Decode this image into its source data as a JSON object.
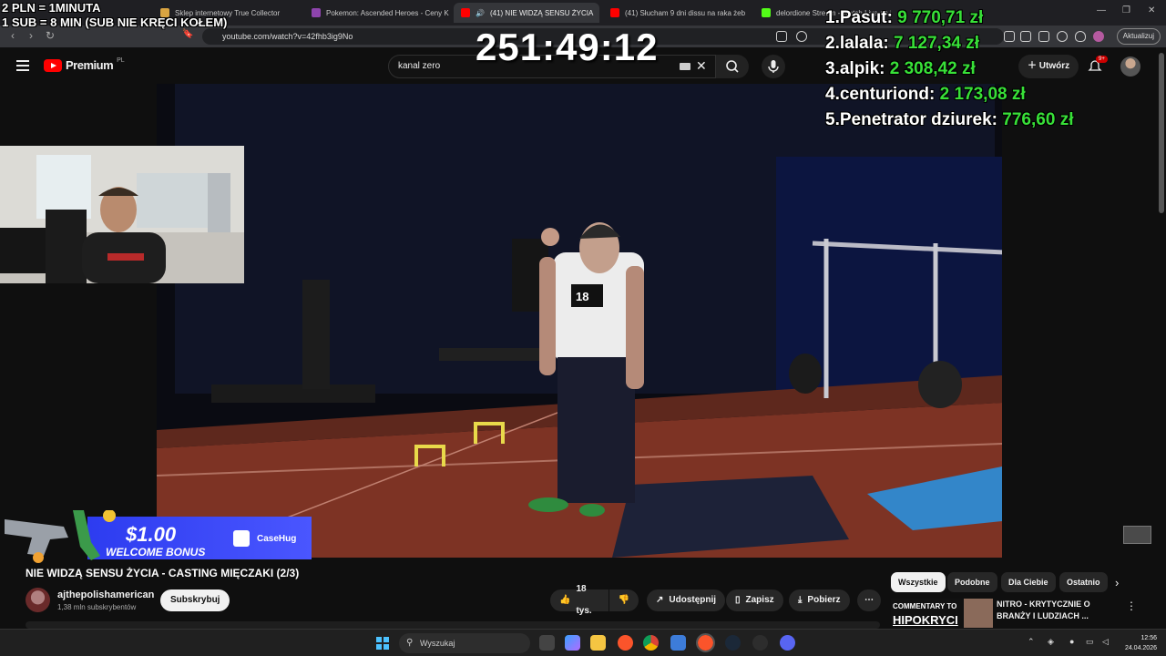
{
  "browser": {
    "tabs": [
      {
        "label": "Sklep internetowy True Collector",
        "favicon_color": "#d9a441"
      },
      {
        "label": "Pokemon: Ascended Heroes - Ceny K",
        "favicon_color": "#8e44ad"
      },
      {
        "label": "(41) NIE WIDZĄ SENSU ŻYCIA",
        "favicon_color": "#ff0000",
        "active": true
      },
      {
        "label": "(41) Słucham 9 dni dissu na raka żeb",
        "favicon_color": "#ff0000"
      },
      {
        "label": "delordione Stream - Watch Live on K",
        "favicon_color": "#53fc18"
      }
    ],
    "url": "youtube.com/watch?v=42fhb3ig9No",
    "update_label": "Aktualizuj"
  },
  "youtube": {
    "brand": "Premium",
    "region": "PL",
    "search_value": "kanal zero",
    "create_label": "Utwórz",
    "notification_count": "9+"
  },
  "overlay": {
    "rate_line1": "2 PLN = 1MINUTA",
    "rate_line2": "1 SUB = 8 MIN (SUB NIE KRĘCI KOŁEM)",
    "timer": "251:49:12",
    "leaderboard": [
      {
        "rank": "1.",
        "name": "Pasut:",
        "amount": "9 770,71 zł"
      },
      {
        "rank": "2.",
        "name": "lalala:",
        "amount": "7 127,34 zł"
      },
      {
        "rank": "3.",
        "name": "alpik:",
        "amount": "2 308,42 zł"
      },
      {
        "rank": "4.",
        "name": "centuriond:",
        "amount": "2 173,08 zł"
      },
      {
        "rank": "5.",
        "name": "Penetrator dziurek:",
        "amount": "776,60 zł"
      }
    ]
  },
  "ad": {
    "amount": "$1.00",
    "text": "WELCOME BONUS",
    "brand": "CaseHug"
  },
  "video": {
    "title": "NIE WIDZĄ SENSU ŻYCIA - CASTING MIĘCZAKI (2/3)",
    "bib_number": "18",
    "channel_name": "ajthepolishamerican",
    "channel_subs": "1,38 mln subskrybentów",
    "subscribe_label": "Subskrybuj",
    "likes": "18 tys.",
    "share_label": "Udostępnij",
    "save_label": "Zapisz",
    "download_label": "Pobierz"
  },
  "chips": [
    "Wszystkie",
    "Podobne",
    "Dla Ciebie",
    "Ostatnio"
  ],
  "recommended": {
    "thumb_text_top": "COMMENTARY TO",
    "thumb_text_bottom": "HIPOKRYCI",
    "title": "NITRO - KRYTYCZNIE O BRANŻY I LUDZIACH ..."
  },
  "taskbar": {
    "search_placeholder": "Wyszukaj",
    "time": "12:56",
    "date": "24.04.2026"
  }
}
